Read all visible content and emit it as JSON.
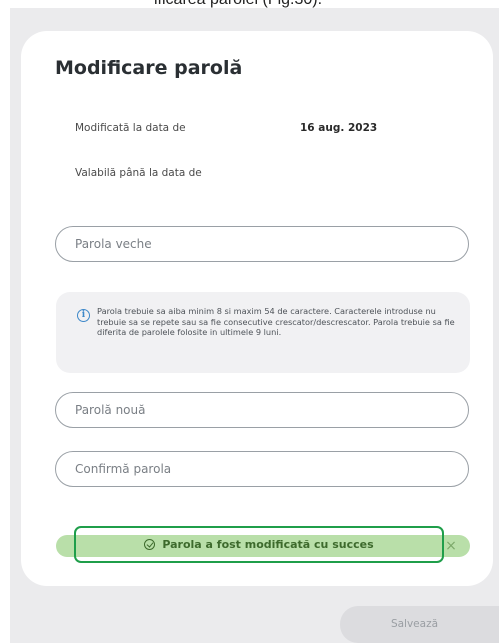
{
  "caption": "ificarea parolei (Fig.30).",
  "card": {
    "title": "Modificare parolă",
    "modified_label": "Modificată la data de",
    "modified_value": "16 aug. 2023",
    "valid_label": "Valabilă până la data de"
  },
  "fields": {
    "old_password_placeholder": "Parola veche",
    "new_password_placeholder": "Parolă nouă",
    "confirm_password_placeholder": "Confirmă parola"
  },
  "notice": {
    "icon": "info-icon",
    "text": "Parola trebuie sa aiba minim 8 si maxim 54 de caractere. Caracterele introduse nu trebuie sa se repete sau sa fie consecutive crescator/descrescator. Parola trebuie sa fie diferita de parolele folosite in ultimele 9 luni."
  },
  "toast": {
    "icon": "check-circle-icon",
    "message": "Parola a fost modificată cu succes",
    "close_symbol": "×"
  },
  "actions": {
    "save_label": "Salvează"
  },
  "colors": {
    "success_bg": "#b9dfa9",
    "success_border": "#1f9e4a",
    "info": "#3d88c9",
    "page_bg": "#ebebed"
  }
}
